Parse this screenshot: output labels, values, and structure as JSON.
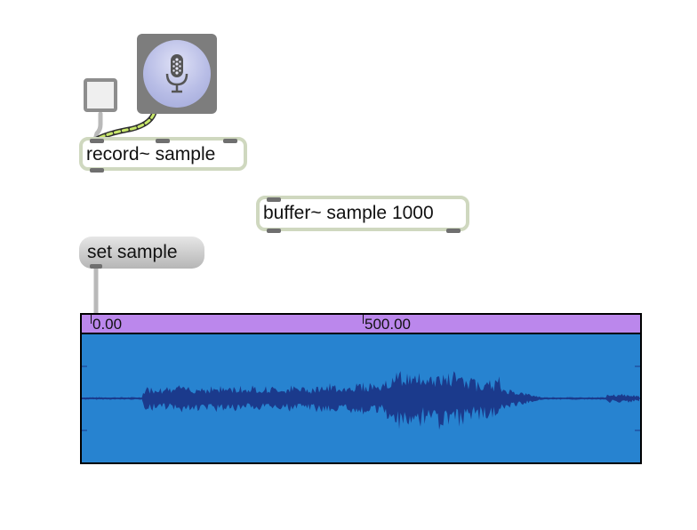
{
  "objects": {
    "record": {
      "text": "record~ sample"
    },
    "buffer": {
      "text": "buffer~ sample 1000"
    }
  },
  "message": {
    "text": "set sample"
  },
  "waveform": {
    "ruler_labels": [
      "0.00",
      "500.00"
    ],
    "colors": {
      "background": "#2783d0",
      "waveform": "#1b3a8c",
      "ruler": "#bb87ec"
    }
  },
  "colors": {
    "object_border": "#cfd8bf",
    "ezadc_background": "#7d7d7d",
    "signal_cord": "#c8e86a"
  },
  "icons": {
    "ezadc": "microphone-icon",
    "toggle": "toggle-icon"
  }
}
